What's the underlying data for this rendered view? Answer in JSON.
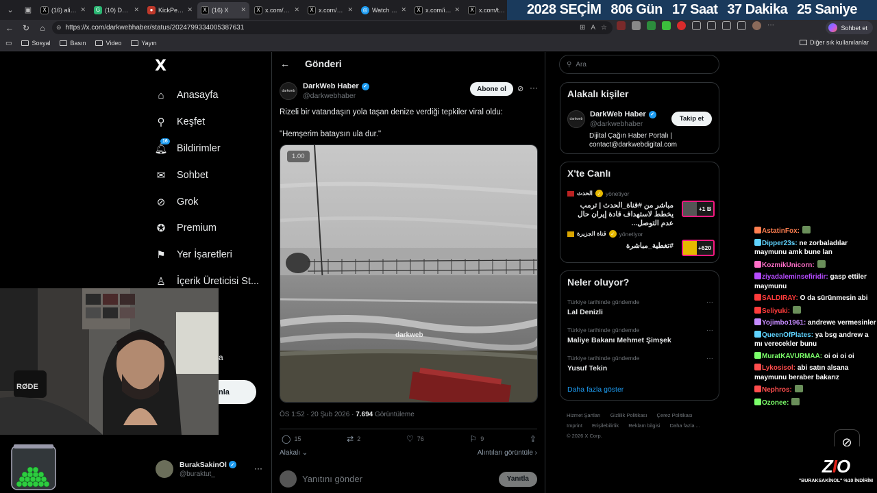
{
  "tabs": [
    {
      "label": "(16) alican",
      "icon": "x-icon"
    },
    {
      "label": "(10) Dashb",
      "icon": "green-g-icon"
    },
    {
      "label": "KickPeek -",
      "icon": "kickpeek-icon"
    },
    {
      "label": "(16) X",
      "icon": "x-icon",
      "active": true
    },
    {
      "label": "x.com/yag",
      "icon": "x-icon"
    },
    {
      "label": "x.com/Stre",
      "icon": "x-icon"
    },
    {
      "label": "Watch Bur",
      "icon": "watch-icon"
    },
    {
      "label": "x.com/i/sta",
      "icon": "x-icon"
    },
    {
      "label": "x.com/tim",
      "icon": "x-icon"
    }
  ],
  "countdown": {
    "election": "2028 SEÇİM",
    "days": "806 Gün",
    "hours": "17 Saat",
    "minutes": "37 Dakika",
    "seconds": "25 Saniye"
  },
  "address": {
    "url": "https://x.com/darkwebhaber/status/2024799334005387631",
    "chat_label": "Sohbet et"
  },
  "bookmarks": {
    "items": [
      "Sosyal",
      "Basın",
      "Video",
      "Yayın"
    ],
    "other": "Diğer sık kullanılanlar"
  },
  "nav": {
    "logo": "X",
    "items": [
      {
        "label": "Anasayfa",
        "icon": "home-icon"
      },
      {
        "label": "Keşfet",
        "icon": "search-icon"
      },
      {
        "label": "Bildirimler",
        "icon": "bell-icon",
        "badge": "16"
      },
      {
        "label": "Sohbet",
        "icon": "mail-icon"
      },
      {
        "label": "Grok",
        "icon": "grok-icon"
      },
      {
        "label": "Premium",
        "icon": "premium-icon"
      },
      {
        "label": "Yer İşaretleri",
        "icon": "bookmark-icon"
      },
      {
        "label": "İçerik Üreticisi St...",
        "icon": "creator-icon"
      }
    ],
    "post_button_partial": "nla",
    "hidden_item_partial": "a"
  },
  "post": {
    "header": "Gönderi",
    "author_name": "DarkWeb Haber",
    "author_handle": "@darkwebhaber",
    "avatar_text": "darkweb",
    "subscribe_label": "Abone ol",
    "text_line1": "Rizeli bir vatandaşın yola taşan denize verdiği tepkiler viral oldu:",
    "text_line2": "\"Hemşerim bataysın ula dur.\"",
    "video_speed": "1.00",
    "watermark": "darkweb",
    "timestamp": "ÖS 1:52 · 20 Şub 2026 · ",
    "views": "7.694",
    "views_label": " Görüntüleme",
    "replies": "15",
    "reposts": "2",
    "likes": "76",
    "bookmarks": "9",
    "related_left": "Alakalı",
    "related_right": "Alıntıları görüntüle",
    "reply_placeholder": "Yanıtını gönder",
    "reply_button": "Yanıtla"
  },
  "right": {
    "search_placeholder": "Ara",
    "related_title": "Alakalı kişiler",
    "related_name": "DarkWeb Haber",
    "related_handle": "@darkwebhaber",
    "follow_label": "Takip et",
    "bio_line1": "Dijital Çağın Haber Portalı |",
    "bio_line2": "contact@darkwebdigital.com",
    "live_title": "X'te Canlı",
    "live": [
      {
        "channel": "الحدث",
        "status": "yönetiyor",
        "title": "مباشر من #قناة_الحدث | ترمب يخطط لاستهداف قادة إيران حال عدم التوصل...",
        "count": "+1 B"
      },
      {
        "channel": "قناة الجزيرة",
        "status": "yönetiyor",
        "title": "#تغطية_مباشرة",
        "count": "+620"
      }
    ],
    "trends_title": "Neler oluyor?",
    "trends": [
      {
        "category": "Türkiye tarihinde gündemde",
        "name": "Lal Denizli"
      },
      {
        "category": "Türkiye tarihinde gündemde",
        "name": "Maliye Bakanı Mehmet Şimşek"
      },
      {
        "category": "Türkiye tarihinde gündemde",
        "name": "Yusuf Tekin"
      }
    ],
    "show_more": "Daha fazla göster",
    "footer_links": [
      "Hizmet Şartları",
      "Gizlilik Politikası",
      "Çerez Politikası",
      "Imprint",
      "Erişilebilirlik",
      "Reklam bilgisi",
      "Daha fazla ..."
    ],
    "copyright": "© 2026 X Corp."
  },
  "chat": [
    {
      "user": "AstatinFox:",
      "color": "#ff7f50",
      "text": ""
    },
    {
      "user": "Dipper23s:",
      "color": "#5fd3ff",
      "text": " ne zorbaladılar maymunu amk bune lan"
    },
    {
      "user": "KozmikUnicorn:",
      "color": "#ff6ec7",
      "text": ""
    },
    {
      "user": "ziyadaleminsefiridir:",
      "color": "#b64bff",
      "text": " gasp ettiler maymunu"
    },
    {
      "user": "SALDIRAY:",
      "color": "#ff3b3b",
      "text": " O da sürünmesin abi"
    },
    {
      "user": "Seliyuki:",
      "color": "#ff3b3b",
      "text": ""
    },
    {
      "user": "Yojimbo1961:",
      "color": "#c58bff",
      "text": " andrewe vermesinler"
    },
    {
      "user": "QueenOfPlates:",
      "color": "#5fd3ff",
      "text": " ya bsg andrew a mı verecekler bunu"
    },
    {
      "user": "MuratKAVURMAA:",
      "color": "#7bff6a",
      "text": " oi oi oi oi"
    },
    {
      "user": "Lykosisol:",
      "color": "#ff4d4d",
      "text": " abi satın alsana maymunu beraber bakarız"
    },
    {
      "user": "Nephros:",
      "color": "#ff4d4d",
      "text": ""
    },
    {
      "user": "Ozonee:",
      "color": "#7bff6a",
      "text": ""
    }
  ],
  "me": {
    "name": "BurakSakinOl",
    "handle": "@buraktut_"
  },
  "promo": {
    "code": "\"BURAKSAKİNOL\" %10 İNDİRİM"
  },
  "webcam": {
    "mic_brand": "RØDE"
  },
  "colors": {
    "accent": "#1d9bf0",
    "background": "#000000",
    "border": "#2f3336",
    "live_border": "#f91880"
  }
}
